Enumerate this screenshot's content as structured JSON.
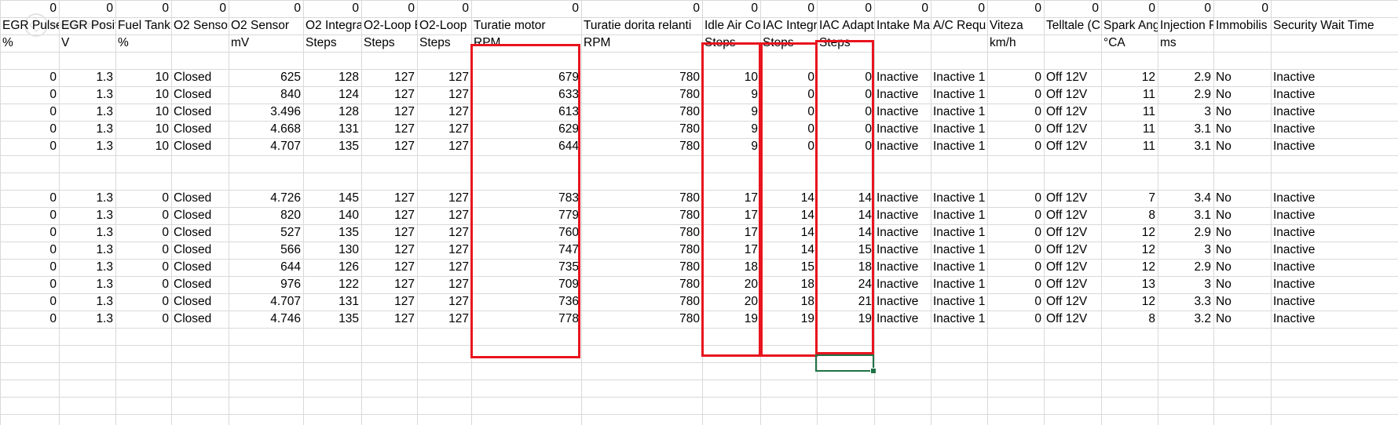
{
  "colors": {
    "grid": "#d9d9d9",
    "highlight": "#e8141e",
    "selection": "#217346",
    "text": "#000000"
  },
  "columns": [
    {
      "header": "EGR Pulse",
      "unit": "%"
    },
    {
      "header": "EGR Posit",
      "unit": "V"
    },
    {
      "header": "Fuel Tank",
      "unit": "%"
    },
    {
      "header": "O2 Sensor",
      "unit": ""
    },
    {
      "header": "O2 Sensor",
      "unit": "mV"
    },
    {
      "header": "O2 Integra",
      "unit": "Steps"
    },
    {
      "header": "O2-Loop E",
      "unit": "Steps"
    },
    {
      "header": "O2-Loop I",
      "unit": "Steps"
    },
    {
      "header": "Turatie motor",
      "unit": "RPM"
    },
    {
      "header": "Turatie dorita relanti",
      "unit": "RPM"
    },
    {
      "header": "Idle Air Co",
      "unit": "Steps"
    },
    {
      "header": "IAC Integr",
      "unit": "Steps"
    },
    {
      "header": "IAC Adapt",
      "unit": "Steps"
    },
    {
      "header": "Intake Ma",
      "unit": ""
    },
    {
      "header": "A/C Requ",
      "unit": ""
    },
    {
      "header": "Viteza",
      "unit": "km/h"
    },
    {
      "header": "Telltale (C",
      "unit": ""
    },
    {
      "header": "Spark Ang",
      "unit": "°CA"
    },
    {
      "header": "Injection F",
      "unit": "ms"
    },
    {
      "header": "Immobilis",
      "unit": ""
    },
    {
      "header": "Security Wait Time",
      "unit": ""
    }
  ],
  "zero_row": [
    "0",
    "0",
    "0",
    "0",
    "0",
    "0",
    "0",
    "0",
    "0",
    "0",
    "0",
    "0",
    "0",
    "0",
    "0",
    "0",
    "0",
    "0",
    "0",
    "0",
    "0"
  ],
  "rows": [
    [
      "0",
      "1.3",
      "10",
      "Closed",
      "625",
      "128",
      "127",
      "127",
      "679",
      "780",
      "10",
      "0",
      "0",
      "Inactive",
      "Inactive 1",
      "0",
      "Off 12V",
      "12",
      "2.9",
      "No",
      "Inactive"
    ],
    [
      "0",
      "1.3",
      "10",
      "Closed",
      "840",
      "124",
      "127",
      "127",
      "633",
      "780",
      "9",
      "0",
      "0",
      "Inactive",
      "Inactive 1",
      "0",
      "Off 12V",
      "11",
      "2.9",
      "No",
      "Inactive"
    ],
    [
      "0",
      "1.3",
      "10",
      "Closed",
      "3.496",
      "128",
      "127",
      "127",
      "613",
      "780",
      "9",
      "0",
      "0",
      "Inactive",
      "Inactive 1",
      "0",
      "Off 12V",
      "11",
      "3",
      "No",
      "Inactive"
    ],
    [
      "0",
      "1.3",
      "10",
      "Closed",
      "4.668",
      "131",
      "127",
      "127",
      "629",
      "780",
      "9",
      "0",
      "0",
      "Inactive",
      "Inactive 1",
      "0",
      "Off 12V",
      "11",
      "3.1",
      "No",
      "Inactive"
    ],
    [
      "0",
      "1.3",
      "10",
      "Closed",
      "4.707",
      "135",
      "127",
      "127",
      "644",
      "780",
      "9",
      "0",
      "0",
      "Inactive",
      "Inactive 1",
      "0",
      "Off 12V",
      "11",
      "3.1",
      "No",
      "Inactive"
    ],
    null,
    null,
    [
      "0",
      "1.3",
      "0",
      "Closed",
      "4.726",
      "145",
      "127",
      "127",
      "783",
      "780",
      "17",
      "14",
      "14",
      "Inactive",
      "Inactive 1",
      "0",
      "Off 12V",
      "7",
      "3.4",
      "No",
      "Inactive"
    ],
    [
      "0",
      "1.3",
      "0",
      "Closed",
      "820",
      "140",
      "127",
      "127",
      "779",
      "780",
      "17",
      "14",
      "14",
      "Inactive",
      "Inactive 1",
      "0",
      "Off 12V",
      "8",
      "3.1",
      "No",
      "Inactive"
    ],
    [
      "0",
      "1.3",
      "0",
      "Closed",
      "527",
      "135",
      "127",
      "127",
      "760",
      "780",
      "17",
      "14",
      "14",
      "Inactive",
      "Inactive 1",
      "0",
      "Off 12V",
      "12",
      "2.9",
      "No",
      "Inactive"
    ],
    [
      "0",
      "1.3",
      "0",
      "Closed",
      "566",
      "130",
      "127",
      "127",
      "747",
      "780",
      "17",
      "14",
      "15",
      "Inactive",
      "Inactive 1",
      "0",
      "Off 12V",
      "12",
      "3",
      "No",
      "Inactive"
    ],
    [
      "0",
      "1.3",
      "0",
      "Closed",
      "644",
      "126",
      "127",
      "127",
      "735",
      "780",
      "18",
      "15",
      "18",
      "Inactive",
      "Inactive 1",
      "0",
      "Off 12V",
      "12",
      "2.9",
      "No",
      "Inactive"
    ],
    [
      "0",
      "1.3",
      "0",
      "Closed",
      "976",
      "122",
      "127",
      "127",
      "709",
      "780",
      "20",
      "18",
      "24",
      "Inactive",
      "Inactive 1",
      "0",
      "Off 12V",
      "13",
      "3",
      "No",
      "Inactive"
    ],
    [
      "0",
      "1.3",
      "0",
      "Closed",
      "4.707",
      "131",
      "127",
      "127",
      "736",
      "780",
      "20",
      "18",
      "21",
      "Inactive",
      "Inactive 1",
      "0",
      "Off 12V",
      "12",
      "3.3",
      "No",
      "Inactive"
    ],
    [
      "0",
      "1.3",
      "0",
      "Closed",
      "4.746",
      "135",
      "127",
      "127",
      "778",
      "780",
      "19",
      "19",
      "19",
      "Inactive",
      "Inactive 1",
      "0",
      "Off 12V",
      "8",
      "3.2",
      "No",
      "Inactive"
    ]
  ]
}
